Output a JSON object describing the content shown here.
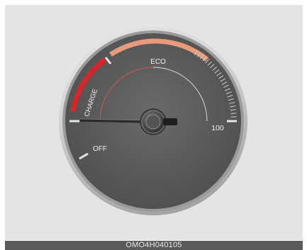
{
  "gauge": {
    "labels": {
      "eco": "ECO",
      "charge": "CHARGE",
      "off": "OFF",
      "max": "100"
    },
    "colors": {
      "charge_zone": "#d8252a",
      "eco_zone": "#e89a7a",
      "dial_face": "#5f5f5f",
      "bezel": "#d9d9d9",
      "needle": "#2a2a2a"
    }
  },
  "caption": {
    "code": "OMO4H040105"
  }
}
